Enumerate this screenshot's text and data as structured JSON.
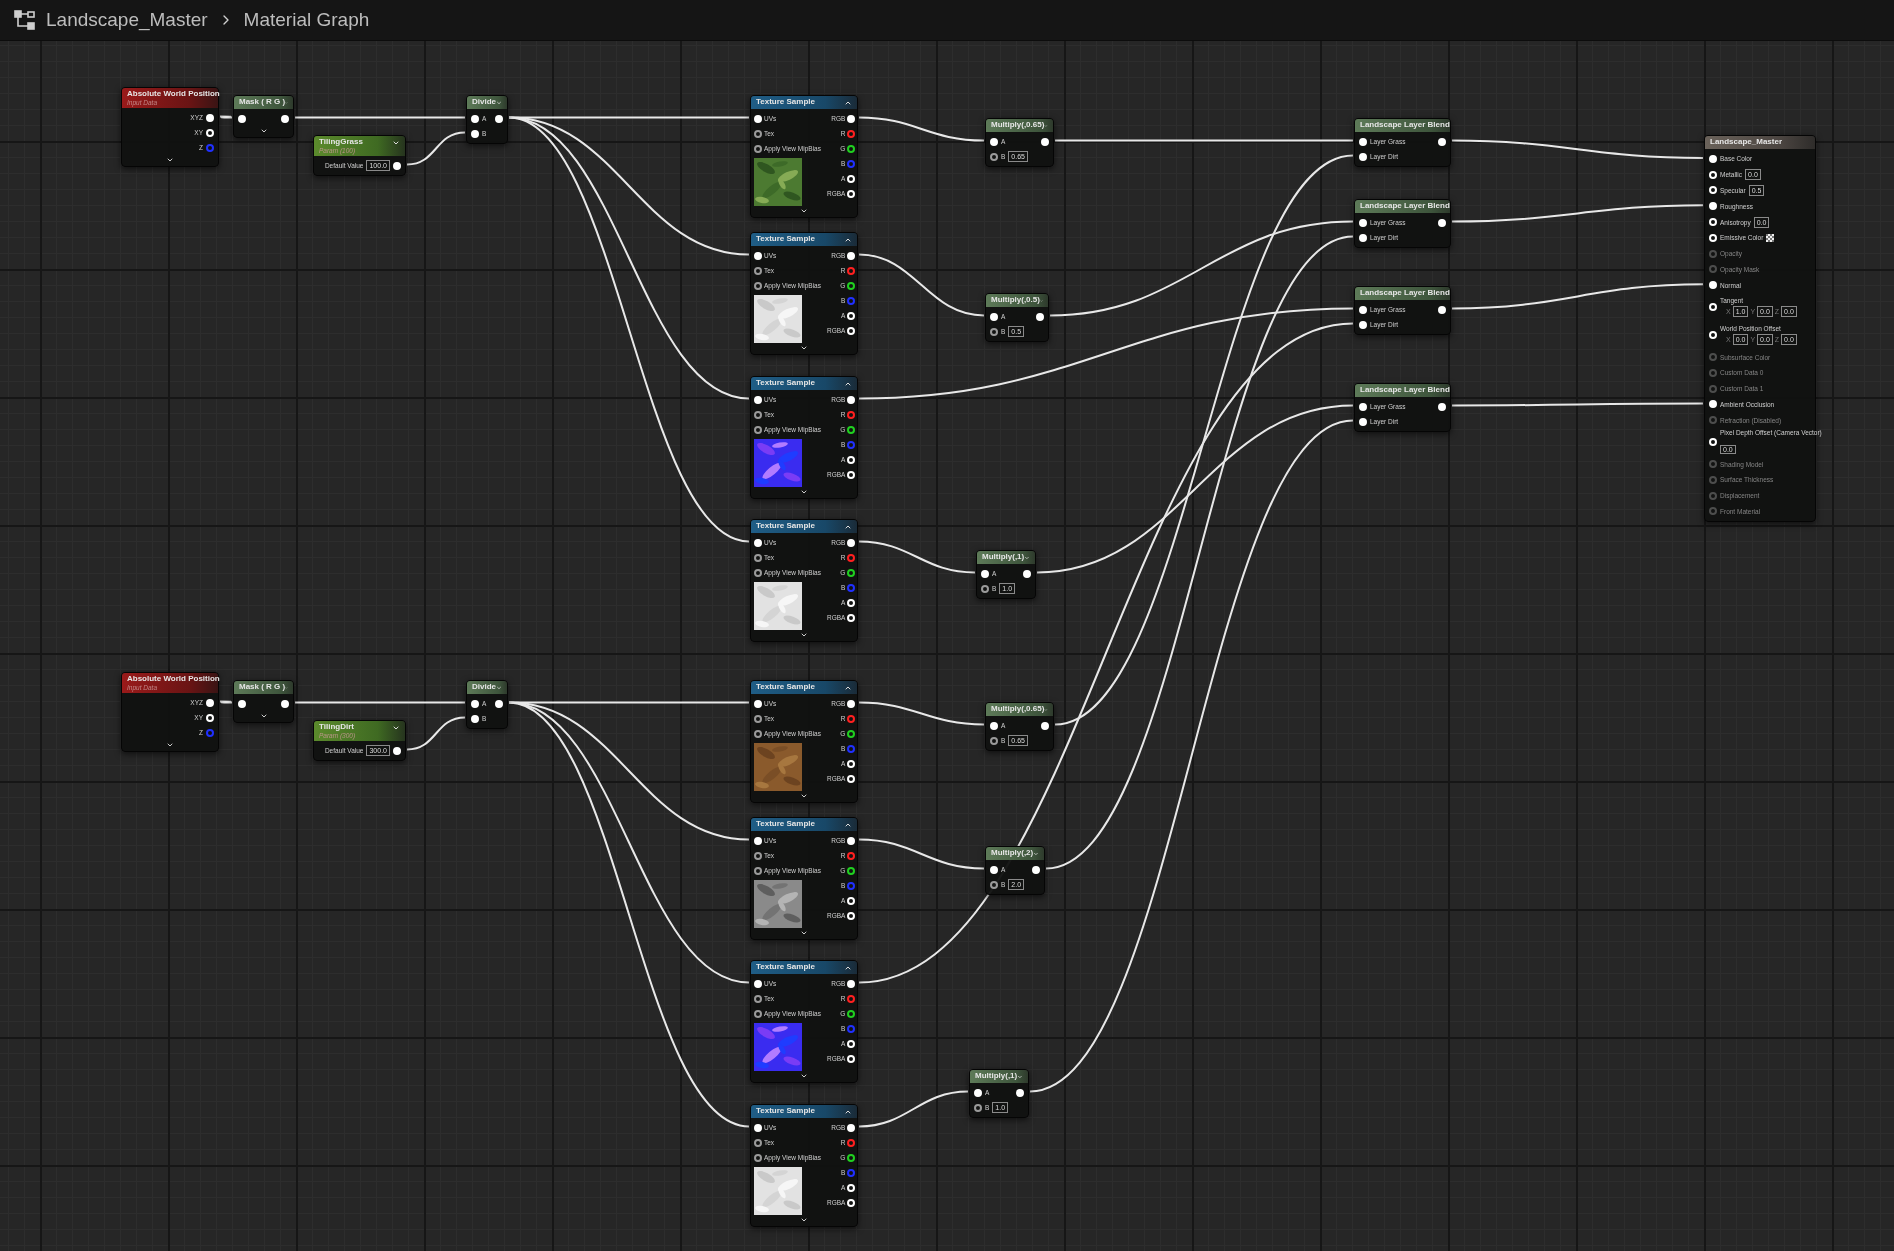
{
  "breadcrumb": [
    {
      "label": "Landscape_Master"
    },
    {
      "label": "Material Graph"
    }
  ],
  "nodes": [
    {
      "kind": "input",
      "title": "Absolute World Position",
      "subtitle": "Input Data",
      "outputs": [
        {
          "label": "XYZ",
          "connected": true
        },
        {
          "label": "XY",
          "connected": false
        },
        {
          "label": "Z",
          "connected": false,
          "color": "#2030ff"
        }
      ]
    },
    {
      "kind": "mask",
      "title": "Mask ( R G )",
      "input_connected": true,
      "output_connected": true
    },
    {
      "kind": "param",
      "title": "TilingGrass",
      "subtitle": "Param (100)",
      "label": "Default Value",
      "value": "100.0",
      "output_connected": true
    },
    {
      "kind": "divide",
      "title": "Divide",
      "inputs": [
        {
          "label": "A",
          "connected": true
        },
        {
          "label": "B",
          "connected": true
        }
      ],
      "output_connected": true
    },
    {
      "kind": "input",
      "title": "Absolute World Position",
      "subtitle": "Input Data",
      "outputs": [
        {
          "label": "XYZ",
          "connected": true
        },
        {
          "label": "XY",
          "connected": false
        },
        {
          "label": "Z",
          "connected": false,
          "color": "#2030ff"
        }
      ]
    },
    {
      "kind": "mask",
      "title": "Mask ( R G )",
      "input_connected": true,
      "output_connected": true
    },
    {
      "kind": "param",
      "title": "TilingDirt",
      "subtitle": "Param (300)",
      "label": "Default Value",
      "value": "300.0",
      "output_connected": true
    },
    {
      "kind": "divide",
      "title": "Divide",
      "inputs": [
        {
          "label": "A",
          "connected": true
        },
        {
          "label": "B",
          "connected": true
        }
      ],
      "output_connected": true
    },
    {
      "kind": "texture",
      "title": "Texture Sample",
      "inputs": [
        {
          "label": "UVs",
          "connected": true
        },
        {
          "label": "Tex",
          "connected": false
        },
        {
          "label": "Apply View MipBias",
          "connected": false
        }
      ],
      "outputs": [
        {
          "label": "RGB",
          "connected": true,
          "color": "#ffffff"
        },
        {
          "label": "R",
          "connected": false,
          "color": "#ff2020"
        },
        {
          "label": "G",
          "connected": false,
          "color": "#20d020"
        },
        {
          "label": "B",
          "connected": false,
          "color": "#2030ff"
        },
        {
          "label": "A",
          "connected": false,
          "color": "#ffffff"
        },
        {
          "label": "RGBA",
          "connected": false,
          "color": "#ffffff"
        }
      ]
    },
    {
      "kind": "texture",
      "title": "Texture Sample",
      "inputs": [
        {
          "label": "UVs",
          "connected": true
        },
        {
          "label": "Tex",
          "connected": false
        },
        {
          "label": "Apply View MipBias",
          "connected": false
        }
      ],
      "outputs": [
        {
          "label": "RGB",
          "connected": true,
          "color": "#ffffff"
        },
        {
          "label": "R",
          "connected": false,
          "color": "#ff2020"
        },
        {
          "label": "G",
          "connected": false,
          "color": "#20d020"
        },
        {
          "label": "B",
          "connected": false,
          "color": "#2030ff"
        },
        {
          "label": "A",
          "connected": false,
          "color": "#ffffff"
        },
        {
          "label": "RGBA",
          "connected": false,
          "color": "#ffffff"
        }
      ]
    },
    {
      "kind": "texture",
      "title": "Texture Sample",
      "inputs": [
        {
          "label": "UVs",
          "connected": true
        },
        {
          "label": "Tex",
          "connected": false
        },
        {
          "label": "Apply View MipBias",
          "connected": false
        }
      ],
      "outputs": [
        {
          "label": "RGB",
          "connected": true,
          "color": "#ffffff"
        },
        {
          "label": "R",
          "connected": false,
          "color": "#ff2020"
        },
        {
          "label": "G",
          "connected": false,
          "color": "#20d020"
        },
        {
          "label": "B",
          "connected": false,
          "color": "#2030ff"
        },
        {
          "label": "A",
          "connected": false,
          "color": "#ffffff"
        },
        {
          "label": "RGBA",
          "connected": false,
          "color": "#ffffff"
        }
      ]
    },
    {
      "kind": "texture",
      "title": "Texture Sample",
      "inputs": [
        {
          "label": "UVs",
          "connected": true
        },
        {
          "label": "Tex",
          "connected": false
        },
        {
          "label": "Apply View MipBias",
          "connected": false
        }
      ],
      "outputs": [
        {
          "label": "RGB",
          "connected": true,
          "color": "#ffffff"
        },
        {
          "label": "R",
          "connected": false,
          "color": "#ff2020"
        },
        {
          "label": "G",
          "connected": false,
          "color": "#20d020"
        },
        {
          "label": "B",
          "connected": false,
          "color": "#2030ff"
        },
        {
          "label": "A",
          "connected": false,
          "color": "#ffffff"
        },
        {
          "label": "RGBA",
          "connected": false,
          "color": "#ffffff"
        }
      ]
    },
    {
      "kind": "texture",
      "title": "Texture Sample",
      "inputs": [
        {
          "label": "UVs",
          "connected": true
        },
        {
          "label": "Tex",
          "connected": false
        },
        {
          "label": "Apply View MipBias",
          "connected": false
        }
      ],
      "outputs": [
        {
          "label": "RGB",
          "connected": true,
          "color": "#ffffff"
        },
        {
          "label": "R",
          "connected": false,
          "color": "#ff2020"
        },
        {
          "label": "G",
          "connected": false,
          "color": "#20d020"
        },
        {
          "label": "B",
          "connected": false,
          "color": "#2030ff"
        },
        {
          "label": "A",
          "connected": false,
          "color": "#ffffff"
        },
        {
          "label": "RGBA",
          "connected": false,
          "color": "#ffffff"
        }
      ]
    },
    {
      "kind": "texture",
      "title": "Texture Sample",
      "inputs": [
        {
          "label": "UVs",
          "connected": true
        },
        {
          "label": "Tex",
          "connected": false
        },
        {
          "label": "Apply View MipBias",
          "connected": false
        }
      ],
      "outputs": [
        {
          "label": "RGB",
          "connected": true,
          "color": "#ffffff"
        },
        {
          "label": "R",
          "connected": false,
          "color": "#ff2020"
        },
        {
          "label": "G",
          "connected": false,
          "color": "#20d020"
        },
        {
          "label": "B",
          "connected": false,
          "color": "#2030ff"
        },
        {
          "label": "A",
          "connected": false,
          "color": "#ffffff"
        },
        {
          "label": "RGBA",
          "connected": false,
          "color": "#ffffff"
        }
      ]
    },
    {
      "kind": "texture",
      "title": "Texture Sample",
      "inputs": [
        {
          "label": "UVs",
          "connected": true
        },
        {
          "label": "Tex",
          "connected": false
        },
        {
          "label": "Apply View MipBias",
          "connected": false
        }
      ],
      "outputs": [
        {
          "label": "RGB",
          "connected": true,
          "color": "#ffffff"
        },
        {
          "label": "R",
          "connected": false,
          "color": "#ff2020"
        },
        {
          "label": "G",
          "connected": false,
          "color": "#20d020"
        },
        {
          "label": "B",
          "connected": false,
          "color": "#2030ff"
        },
        {
          "label": "A",
          "connected": false,
          "color": "#ffffff"
        },
        {
          "label": "RGBA",
          "connected": false,
          "color": "#ffffff"
        }
      ]
    },
    {
      "kind": "texture",
      "title": "Texture Sample",
      "inputs": [
        {
          "label": "UVs",
          "connected": true
        },
        {
          "label": "Tex",
          "connected": false
        },
        {
          "label": "Apply View MipBias",
          "connected": false
        }
      ],
      "outputs": [
        {
          "label": "RGB",
          "connected": true,
          "color": "#ffffff"
        },
        {
          "label": "R",
          "connected": false,
          "color": "#ff2020"
        },
        {
          "label": "G",
          "connected": false,
          "color": "#20d020"
        },
        {
          "label": "B",
          "connected": false,
          "color": "#2030ff"
        },
        {
          "label": "A",
          "connected": false,
          "color": "#ffffff"
        },
        {
          "label": "RGBA",
          "connected": false,
          "color": "#ffffff"
        }
      ]
    },
    {
      "kind": "multiply",
      "title": "Multiply(,0.65)",
      "inputs": [
        {
          "label": "A",
          "connected": true
        },
        {
          "label": "B",
          "value": "0.65",
          "connected": false
        }
      ],
      "output_connected": true
    },
    {
      "kind": "multiply",
      "title": "Multiply(,0.5)",
      "inputs": [
        {
          "label": "A",
          "connected": true
        },
        {
          "label": "B",
          "value": "0.5",
          "connected": false
        }
      ],
      "output_connected": true
    },
    {
      "kind": "multiply",
      "title": "Multiply(,1)",
      "inputs": [
        {
          "label": "A",
          "connected": true
        },
        {
          "label": "B",
          "value": "1.0",
          "connected": false
        }
      ],
      "output_connected": true
    },
    {
      "kind": "multiply",
      "title": "Multiply(,0.65)",
      "inputs": [
        {
          "label": "A",
          "connected": true
        },
        {
          "label": "B",
          "value": "0.65",
          "connected": false
        }
      ],
      "output_connected": true
    },
    {
      "kind": "multiply",
      "title": "Multiply(,2)",
      "inputs": [
        {
          "label": "A",
          "connected": true
        },
        {
          "label": "B",
          "value": "2.0",
          "connected": false
        }
      ],
      "output_connected": true
    },
    {
      "kind": "multiply",
      "title": "Multiply(,1)",
      "inputs": [
        {
          "label": "A",
          "connected": true
        },
        {
          "label": "B",
          "value": "1.0",
          "connected": false
        }
      ],
      "output_connected": true
    },
    {
      "kind": "blend",
      "title": "Landscape Layer Blend",
      "inputs": [
        {
          "label": "Layer Grass",
          "connected": true
        },
        {
          "label": "Layer Dirt",
          "connected": true
        }
      ],
      "output_connected": true
    },
    {
      "kind": "blend",
      "title": "Landscape Layer Blend",
      "inputs": [
        {
          "label": "Layer Grass",
          "connected": true
        },
        {
          "label": "Layer Dirt",
          "connected": true
        }
      ],
      "output_connected": true
    },
    {
      "kind": "blend",
      "title": "Landscape Layer Blend",
      "inputs": [
        {
          "label": "Layer Grass",
          "connected": true
        },
        {
          "label": "Layer Dirt",
          "connected": true
        }
      ],
      "output_connected": true
    },
    {
      "kind": "blend",
      "title": "Landscape Layer Blend",
      "inputs": [
        {
          "label": "Layer Grass",
          "connected": true
        },
        {
          "label": "Layer Dirt",
          "connected": true
        }
      ],
      "output_connected": true
    },
    {
      "kind": "result",
      "title": "Landscape_Master",
      "inputs": [
        {
          "kind": "plain",
          "label": "Base Color",
          "connected": true,
          "disabled": false
        },
        {
          "kind": "value",
          "label": "Metallic",
          "value": "0.0",
          "connected": false,
          "disabled": false
        },
        {
          "kind": "value",
          "label": "Specular",
          "value": "0.5",
          "connected": false,
          "disabled": false
        },
        {
          "kind": "plain",
          "label": "Roughness",
          "connected": true,
          "disabled": false
        },
        {
          "kind": "value",
          "label": "Anisotropy",
          "value": "0.0",
          "connected": false,
          "disabled": false
        },
        {
          "kind": "swatch",
          "label": "Emissive Color",
          "connected": false,
          "disabled": false
        },
        {
          "kind": "plain",
          "label": "Opacity",
          "connected": false,
          "disabled": true
        },
        {
          "kind": "plain",
          "label": "Opacity Mask",
          "connected": false,
          "disabled": true
        },
        {
          "kind": "plain",
          "label": "Normal",
          "connected": true,
          "disabled": false
        },
        {
          "kind": "vector",
          "label": "Tangent",
          "axes": [
            {
              "axis": "X",
              "value": "1.0"
            },
            {
              "axis": "Y",
              "value": "0.0"
            },
            {
              "axis": "Z",
              "value": "0.0"
            }
          ],
          "connected": false,
          "disabled": false
        },
        {
          "kind": "vector",
          "label": "World Position Offset",
          "axes": [
            {
              "axis": "X",
              "value": "0.0"
            },
            {
              "axis": "Y",
              "value": "0.0"
            },
            {
              "axis": "Z",
              "value": "0.0"
            }
          ],
          "connected": false,
          "disabled": false
        },
        {
          "kind": "plain",
          "label": "Subsurface Color",
          "connected": false,
          "disabled": true
        },
        {
          "kind": "plain",
          "label": "Custom Data 0",
          "connected": false,
          "disabled": true
        },
        {
          "kind": "plain",
          "label": "Custom Data 1",
          "connected": false,
          "disabled": true
        },
        {
          "kind": "plain",
          "label": "Ambient Occlusion",
          "connected": true,
          "disabled": false
        },
        {
          "kind": "plain",
          "label": "Refraction (Disabled)",
          "connected": false,
          "disabled": true
        },
        {
          "kind": "stacked",
          "label": "Pixel Depth Offset (Camera Vector)",
          "value": "0.0",
          "connected": false,
          "disabled": false
        },
        {
          "kind": "plain",
          "label": "Shading Model",
          "connected": false,
          "disabled": true
        },
        {
          "kind": "plain",
          "label": "Surface Thickness",
          "connected": false,
          "disabled": true
        },
        {
          "kind": "plain",
          "label": "Displacement",
          "connected": false,
          "disabled": true
        },
        {
          "kind": "plain",
          "label": "Front Material",
          "connected": false,
          "disabled": true
        }
      ]
    }
  ]
}
